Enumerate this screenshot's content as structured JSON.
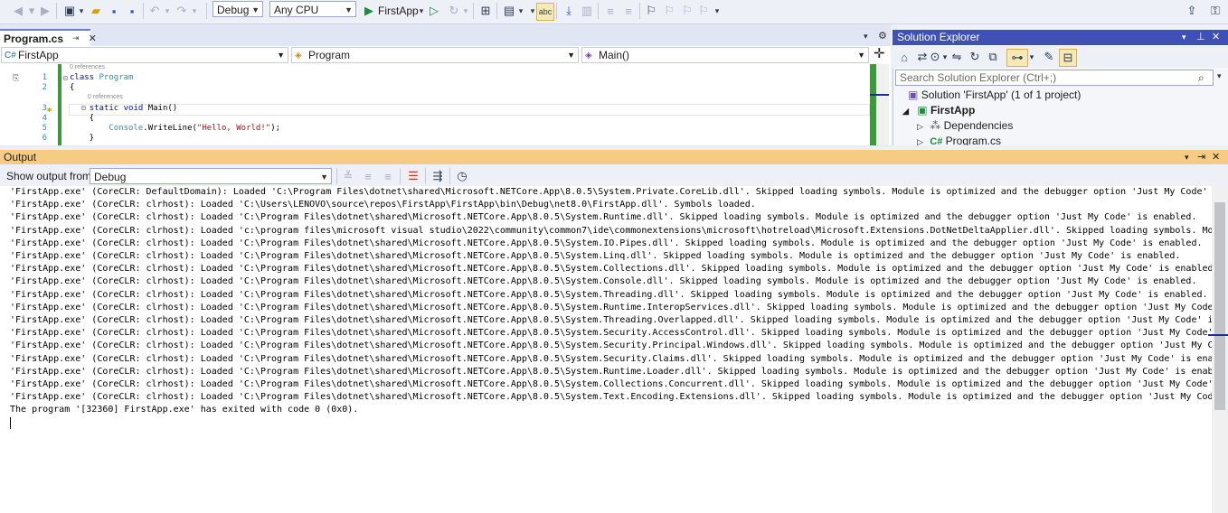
{
  "toolbar": {
    "config": "Debug",
    "platform": "Any CPU",
    "start_label": "FirstApp"
  },
  "editor": {
    "tab": "Program.cs",
    "nav_project": "FirstApp",
    "nav_class": "Program",
    "nav_member": "Main()",
    "lines": [
      {
        "num": "",
        "text": "0 references",
        "ref": true
      },
      {
        "num": "1",
        "parts": [
          [
            "kw",
            "class "
          ],
          [
            "ty",
            "Program"
          ]
        ]
      },
      {
        "num": "2",
        "parts": [
          [
            "pl",
            "{"
          ]
        ]
      },
      {
        "num": "",
        "text": "0 references",
        "ref": true,
        "indent": 1
      },
      {
        "num": "3",
        "parts": [
          [
            "pl",
            "    "
          ],
          [
            "kw",
            "static void "
          ],
          [
            "pl",
            "Main()"
          ]
        ]
      },
      {
        "num": "4",
        "parts": [
          [
            "pl",
            "    {"
          ]
        ]
      },
      {
        "num": "5",
        "parts": [
          [
            "pl",
            "        "
          ],
          [
            "ty",
            "Console"
          ],
          [
            "pl",
            "."
          ],
          [
            "pl",
            "WriteLine("
          ],
          [
            "st",
            "\"Hello, World!\""
          ],
          [
            "pl",
            ");"
          ]
        ]
      },
      {
        "num": "6",
        "parts": [
          [
            "pl",
            "    }"
          ]
        ]
      }
    ]
  },
  "solution": {
    "title": "Solution Explorer",
    "search_placeholder": "Search Solution Explorer (Ctrl+;)",
    "items": [
      {
        "label": "Solution 'FirstApp' (1 of 1 project)"
      },
      {
        "label": "FirstApp"
      },
      {
        "label": "Dependencies"
      },
      {
        "label": "Program.cs"
      }
    ]
  },
  "output": {
    "title": "Output",
    "show_from_label": "Show output from:",
    "source": "Debug",
    "lines": [
      "'FirstApp.exe' (CoreCLR: DefaultDomain): Loaded 'C:\\Program Files\\dotnet\\shared\\Microsoft.NETCore.App\\8.0.5\\System.Private.CoreLib.dll'. Skipped loading symbols. Module is optimized and the debugger option 'Just My Code' is enabled.",
      "'FirstApp.exe' (CoreCLR: clrhost): Loaded 'C:\\Users\\LENOVO\\source\\repos\\FirstApp\\FirstApp\\bin\\Debug\\net8.0\\FirstApp.dll'. Symbols loaded.",
      "'FirstApp.exe' (CoreCLR: clrhost): Loaded 'C:\\Program Files\\dotnet\\shared\\Microsoft.NETCore.App\\8.0.5\\System.Runtime.dll'. Skipped loading symbols. Module is optimized and the debugger option 'Just My Code' is enabled.",
      "'FirstApp.exe' (CoreCLR: clrhost): Loaded 'c:\\program files\\microsoft visual studio\\2022\\community\\common7\\ide\\commonextensions\\microsoft\\hotreload\\Microsoft.Extensions.DotNetDeltaApplier.dll'. Skipped loading symbols. Module is opti",
      "'FirstApp.exe' (CoreCLR: clrhost): Loaded 'C:\\Program Files\\dotnet\\shared\\Microsoft.NETCore.App\\8.0.5\\System.IO.Pipes.dll'. Skipped loading symbols. Module is optimized and the debugger option 'Just My Code' is enabled.",
      "'FirstApp.exe' (CoreCLR: clrhost): Loaded 'C:\\Program Files\\dotnet\\shared\\Microsoft.NETCore.App\\8.0.5\\System.Linq.dll'. Skipped loading symbols. Module is optimized and the debugger option 'Just My Code' is enabled.",
      "'FirstApp.exe' (CoreCLR: clrhost): Loaded 'C:\\Program Files\\dotnet\\shared\\Microsoft.NETCore.App\\8.0.5\\System.Collections.dll'. Skipped loading symbols. Module is optimized and the debugger option 'Just My Code' is enabled.",
      "'FirstApp.exe' (CoreCLR: clrhost): Loaded 'C:\\Program Files\\dotnet\\shared\\Microsoft.NETCore.App\\8.0.5\\System.Console.dll'. Skipped loading symbols. Module is optimized and the debugger option 'Just My Code' is enabled.",
      "'FirstApp.exe' (CoreCLR: clrhost): Loaded 'C:\\Program Files\\dotnet\\shared\\Microsoft.NETCore.App\\8.0.5\\System.Threading.dll'. Skipped loading symbols. Module is optimized and the debugger option 'Just My Code' is enabled.",
      "'FirstApp.exe' (CoreCLR: clrhost): Loaded 'C:\\Program Files\\dotnet\\shared\\Microsoft.NETCore.App\\8.0.5\\System.Runtime.InteropServices.dll'. Skipped loading symbols. Module is optimized and the debugger option 'Just My Code' is enabled",
      "'FirstApp.exe' (CoreCLR: clrhost): Loaded 'C:\\Program Files\\dotnet\\shared\\Microsoft.NETCore.App\\8.0.5\\System.Threading.Overlapped.dll'. Skipped loading symbols. Module is optimized and the debugger option 'Just My Code' is enabled.",
      "'FirstApp.exe' (CoreCLR: clrhost): Loaded 'C:\\Program Files\\dotnet\\shared\\Microsoft.NETCore.App\\8.0.5\\System.Security.AccessControl.dll'. Skipped loading symbols. Module is optimized and the debugger option 'Just My Code' is enabled.",
      "'FirstApp.exe' (CoreCLR: clrhost): Loaded 'C:\\Program Files\\dotnet\\shared\\Microsoft.NETCore.App\\8.0.5\\System.Security.Principal.Windows.dll'. Skipped loading symbols. Module is optimized and the debugger option 'Just My Code' is enab",
      "'FirstApp.exe' (CoreCLR: clrhost): Loaded 'C:\\Program Files\\dotnet\\shared\\Microsoft.NETCore.App\\8.0.5\\System.Security.Claims.dll'. Skipped loading symbols. Module is optimized and the debugger option 'Just My Code' is enabled.",
      "'FirstApp.exe' (CoreCLR: clrhost): Loaded 'C:\\Program Files\\dotnet\\shared\\Microsoft.NETCore.App\\8.0.5\\System.Runtime.Loader.dll'. Skipped loading symbols. Module is optimized and the debugger option 'Just My Code' is enabled.",
      "'FirstApp.exe' (CoreCLR: clrhost): Loaded 'C:\\Program Files\\dotnet\\shared\\Microsoft.NETCore.App\\8.0.5\\System.Collections.Concurrent.dll'. Skipped loading symbols. Module is optimized and the debugger option 'Just My Code' is enabled.",
      "'FirstApp.exe' (CoreCLR: clrhost): Loaded 'C:\\Program Files\\dotnet\\shared\\Microsoft.NETCore.App\\8.0.5\\System.Text.Encoding.Extensions.dll'. Skipped loading symbols. Module is optimized and the debugger option 'Just My Code' is enable",
      "The program '[32360] FirstApp.exe' has exited with code 0 (0x0)."
    ]
  }
}
